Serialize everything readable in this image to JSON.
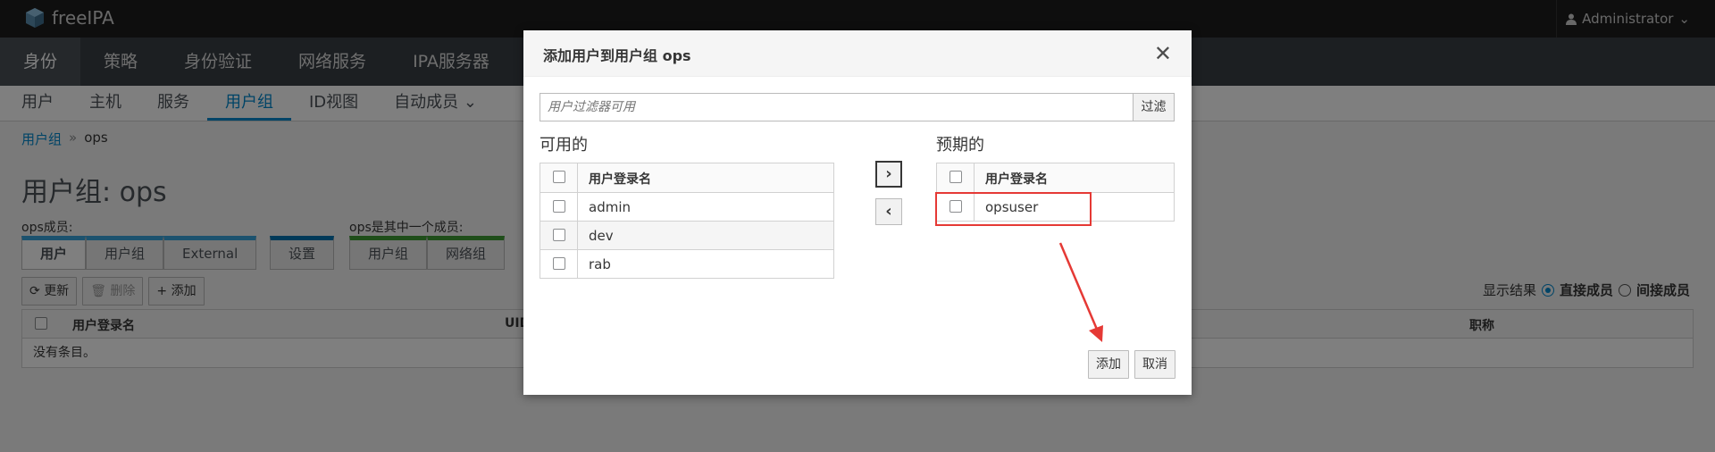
{
  "app": {
    "brand": "freeIPA",
    "user": "Administrator"
  },
  "nav_primary": [
    "身份",
    "策略",
    "身份验证",
    "网络服务",
    "IPA服务器"
  ],
  "nav_secondary": [
    "用户",
    "主机",
    "服务",
    "用户组",
    "ID视图",
    "自动成员 ⌄"
  ],
  "breadcrumb": {
    "parent": "用户组",
    "separator": "»",
    "current": "ops"
  },
  "page_title": "用户组: ops",
  "members_label": "ops成员:",
  "member_of_label": "ops是其中一个成员:",
  "member_tabs": [
    "用户",
    "用户组",
    "External"
  ],
  "settings_tab": "设置",
  "member_of_tabs": [
    "用户组",
    "网络组"
  ],
  "toolbar": {
    "refresh": "更新",
    "delete": "删除",
    "add": "添加"
  },
  "show_results": {
    "label": "显示结果",
    "direct": "直接成员",
    "indirect": "间接成员"
  },
  "main_table": {
    "col_login": "用户登录名",
    "col_uid": "UID",
    "col_title": "职称",
    "empty": "没有条目。"
  },
  "dialog": {
    "title": "添加用户到用户组 ops",
    "close": "✕",
    "filter_placeholder": "用户过滤器可用",
    "filter_button": "过滤",
    "available_label": "可用的",
    "prospective_label": "预期的",
    "column_header": "用户登录名",
    "available": [
      "admin",
      "dev",
      "rab"
    ],
    "prospective": [
      "opsuser"
    ],
    "move_right": "›",
    "move_left": "‹",
    "add_button": "添加",
    "cancel_button": "取消"
  },
  "colors": {
    "accent": "#0088ce",
    "annotation": "#e53935"
  }
}
